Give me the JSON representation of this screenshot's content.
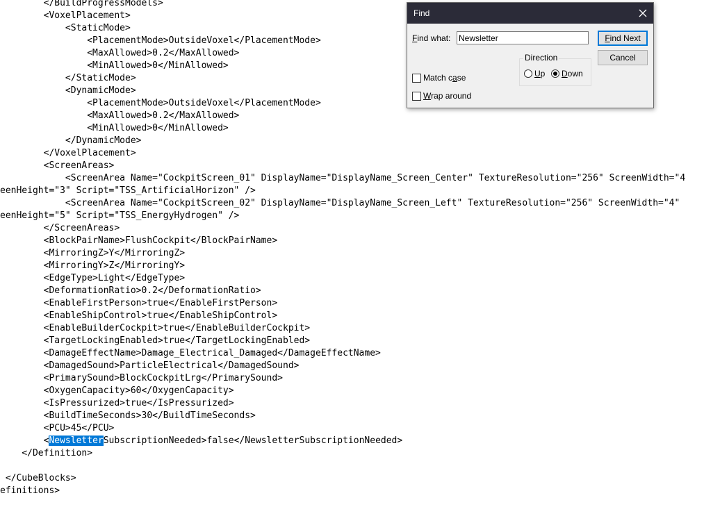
{
  "editor": {
    "lines": [
      {
        "pre": "        </BuildProgressModels>"
      },
      {
        "pre": "        <VoxelPlacement>"
      },
      {
        "pre": "            <StaticMode>"
      },
      {
        "pre": "                <PlacementMode>OutsideVoxel</PlacementMode>"
      },
      {
        "pre": "                <MaxAllowed>0.2</MaxAllowed>"
      },
      {
        "pre": "                <MinAllowed>0</MinAllowed>"
      },
      {
        "pre": "            </StaticMode>"
      },
      {
        "pre": "            <DynamicMode>"
      },
      {
        "pre": "                <PlacementMode>OutsideVoxel</PlacementMode>"
      },
      {
        "pre": "                <MaxAllowed>0.2</MaxAllowed>"
      },
      {
        "pre": "                <MinAllowed>0</MinAllowed>"
      },
      {
        "pre": "            </DynamicMode>"
      },
      {
        "pre": "        </VoxelPlacement>"
      },
      {
        "pre": "        <ScreenAreas>"
      },
      {
        "pre": "            <ScreenArea Name=\"CockpitScreen_01\" DisplayName=\"DisplayName_Screen_Center\" TextureResolution=\"256\" ScreenWidth=\"4"
      },
      {
        "pre": "eenHeight=\"3\" Script=\"TSS_ArtificialHorizon\" />"
      },
      {
        "pre": "            <ScreenArea Name=\"CockpitScreen_02\" DisplayName=\"DisplayName_Screen_Left\" TextureResolution=\"256\" ScreenWidth=\"4\""
      },
      {
        "pre": "eenHeight=\"5\" Script=\"TSS_EnergyHydrogen\" />"
      },
      {
        "pre": "        </ScreenAreas>"
      },
      {
        "pre": "        <BlockPairName>FlushCockpit</BlockPairName>"
      },
      {
        "pre": "        <MirroringZ>Y</MirroringZ>"
      },
      {
        "pre": "        <MirroringY>Z</MirroringY>"
      },
      {
        "pre": "        <EdgeType>Light</EdgeType>"
      },
      {
        "pre": "        <DeformationRatio>0.2</DeformationRatio>"
      },
      {
        "pre": "        <EnableFirstPerson>true</EnableFirstPerson>"
      },
      {
        "pre": "        <EnableShipControl>true</EnableShipControl>"
      },
      {
        "pre": "        <EnableBuilderCockpit>true</EnableBuilderCockpit>"
      },
      {
        "pre": "        <TargetLockingEnabled>true</TargetLockingEnabled>"
      },
      {
        "pre": "        <DamageEffectName>Damage_Electrical_Damaged</DamageEffectName>"
      },
      {
        "pre": "        <DamagedSound>ParticleElectrical</DamagedSound>"
      },
      {
        "pre": "        <PrimarySound>BlockCockpitLrg</PrimarySound>"
      },
      {
        "pre": "        <OxygenCapacity>60</OxygenCapacity>"
      },
      {
        "pre": "        <IsPressurized>true</IsPressurized>"
      },
      {
        "pre": "        <BuildTimeSeconds>30</BuildTimeSeconds>"
      },
      {
        "pre": "        <PCU>45</PCU>"
      },
      {
        "pre": "        <",
        "sel": "Newsletter",
        "post": "SubscriptionNeeded>false</NewsletterSubscriptionNeeded>"
      },
      {
        "pre": "    </Definition>"
      },
      {
        "pre": ""
      },
      {
        "pre": " </CubeBlocks>"
      },
      {
        "pre": "efinitions>"
      }
    ]
  },
  "find_dialog": {
    "title": "Find",
    "close_glyph": "✕",
    "find_what_label": "Find what:",
    "find_what_value": "Newsletter",
    "find_next_label": "Find Next",
    "cancel_label": "Cancel",
    "direction_label": "Direction",
    "up_label": "Up",
    "down_label": "Down",
    "direction_selected": "down",
    "match_case_label": "Match case",
    "match_case_checked": false,
    "wrap_around_label": "Wrap around",
    "wrap_around_checked": false
  }
}
